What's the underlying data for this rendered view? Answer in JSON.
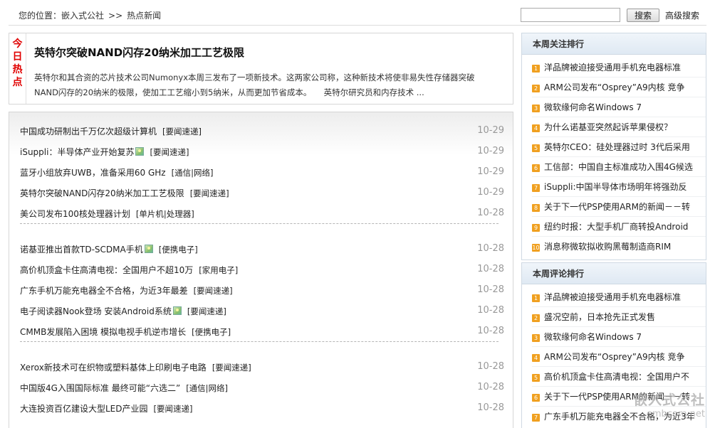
{
  "breadcrumb": {
    "prefix": "您的位置：",
    "site": "嵌入式公社",
    "sep": ">>",
    "current": "热点新闻"
  },
  "search": {
    "value": "",
    "button_label": "搜索",
    "advanced_label": "高级搜索"
  },
  "hot": {
    "label_lines": [
      "今",
      "日",
      "热",
      "点"
    ],
    "title": "英特尔突破NAND闪存20纳米加工工艺极限",
    "description": "英特尔和其合资的芯片技术公司Numonyx本周三发布了一项新技术。这两家公司称，这种新技术将使非易失性存储器突破NAND闪存的20纳米的极限，使加工工艺缩小到5纳米，从而更加节省成本。　　英特尔研究员和内存技术 ..."
  },
  "news_groups": [
    [
      {
        "title": "中国成功研制出千万亿次超级计算机",
        "tag": "[要闻速递]",
        "date": "10-29",
        "has_pic": false
      },
      {
        "title": "iSuppli：半导体产业开始复苏",
        "tag": "[要闻速递]",
        "date": "10-29",
        "has_pic": true
      },
      {
        "title": "蓝牙小组放弃UWB，准备采用60 GHz",
        "tag": "[通信|网络]",
        "date": "10-29",
        "has_pic": false
      },
      {
        "title": "英特尔突破NAND闪存20纳米加工工艺极限",
        "tag": "[要闻速递]",
        "date": "10-29",
        "has_pic": false
      },
      {
        "title": "美公司发布100核处理器计划",
        "tag": "[单片机|处理器]",
        "date": "10-28",
        "has_pic": false
      }
    ],
    [
      {
        "title": "诺基亚推出首款TD-SCDMA手机",
        "tag": "[便携电子]",
        "date": "10-28",
        "has_pic": true
      },
      {
        "title": "高价机顶盒卡住高清电视：全国用户不超10万",
        "tag": "[家用电子]",
        "date": "10-28",
        "has_pic": false
      },
      {
        "title": "广东手机万能充电器全不合格，为近3年最差",
        "tag": "[要闻速递]",
        "date": "10-28",
        "has_pic": false
      },
      {
        "title": "电子阅读器Nook登场 安装Android系统",
        "tag": "[要闻速递]",
        "date": "10-28",
        "has_pic": true
      },
      {
        "title": "CMMB发展陷入困境 模拟电视手机逆市增长",
        "tag": "[便携电子]",
        "date": "10-28",
        "has_pic": false
      }
    ],
    [
      {
        "title": "Xerox新技术可在织物或塑料基体上印刷电子电路",
        "tag": "[要闻速递]",
        "date": "10-28",
        "has_pic": false
      },
      {
        "title": "中国版4G入围国际标准 最终可能“六选二”",
        "tag": "[通信|网络]",
        "date": "10-28",
        "has_pic": false
      },
      {
        "title": "大连投资百亿建设大型LED产业园",
        "tag": "[要闻速递]",
        "date": "10-28",
        "has_pic": false
      }
    ]
  ],
  "week_focus": {
    "title": "本周关注排行",
    "items": [
      {
        "num": "1",
        "text": "洋品牌被迫接受通用手机充电器标准"
      },
      {
        "num": "2",
        "text": "ARM公司发布“Osprey”A9内核 竞争"
      },
      {
        "num": "3",
        "text": "微软缘何命名Windows 7"
      },
      {
        "num": "4",
        "text": "为什么诺基亚突然起诉苹果侵权？"
      },
      {
        "num": "5",
        "text": "英特尔CEO：硅处理器过时 3代后采用"
      },
      {
        "num": "6",
        "text": "工信部：中国自主标准成功入围4G候选"
      },
      {
        "num": "7",
        "text": "iSuppli:中国半导体市场明年将强劲反"
      },
      {
        "num": "8",
        "text": "关于下一代PSP使用ARM的新闻－－转"
      },
      {
        "num": "9",
        "text": "纽约时报：大型手机厂商转投Android"
      },
      {
        "num": "10",
        "text": "消息称微软拟收购黑莓制造商RIM"
      }
    ]
  },
  "week_comments": {
    "title": "本周评论排行",
    "items": [
      {
        "num": "1",
        "text": "洋品牌被迫接受通用手机充电器标准"
      },
      {
        "num": "2",
        "text": "盛况空前，日本抢先正式发售"
      },
      {
        "num": "3",
        "text": "微软缘何命名Windows 7"
      },
      {
        "num": "4",
        "text": "ARM公司发布“Osprey”A9内核 竞争"
      },
      {
        "num": "5",
        "text": "高价机顶盒卡住高清电视：全国用户不"
      },
      {
        "num": "6",
        "text": "关于下一代PSP使用ARM的新闻－－转"
      },
      {
        "num": "7",
        "text": "广东手机万能充电器全不合格，为近3年"
      }
    ]
  },
  "watermark": {
    "cn": "嵌入式公社",
    "en": "embcom.net"
  }
}
